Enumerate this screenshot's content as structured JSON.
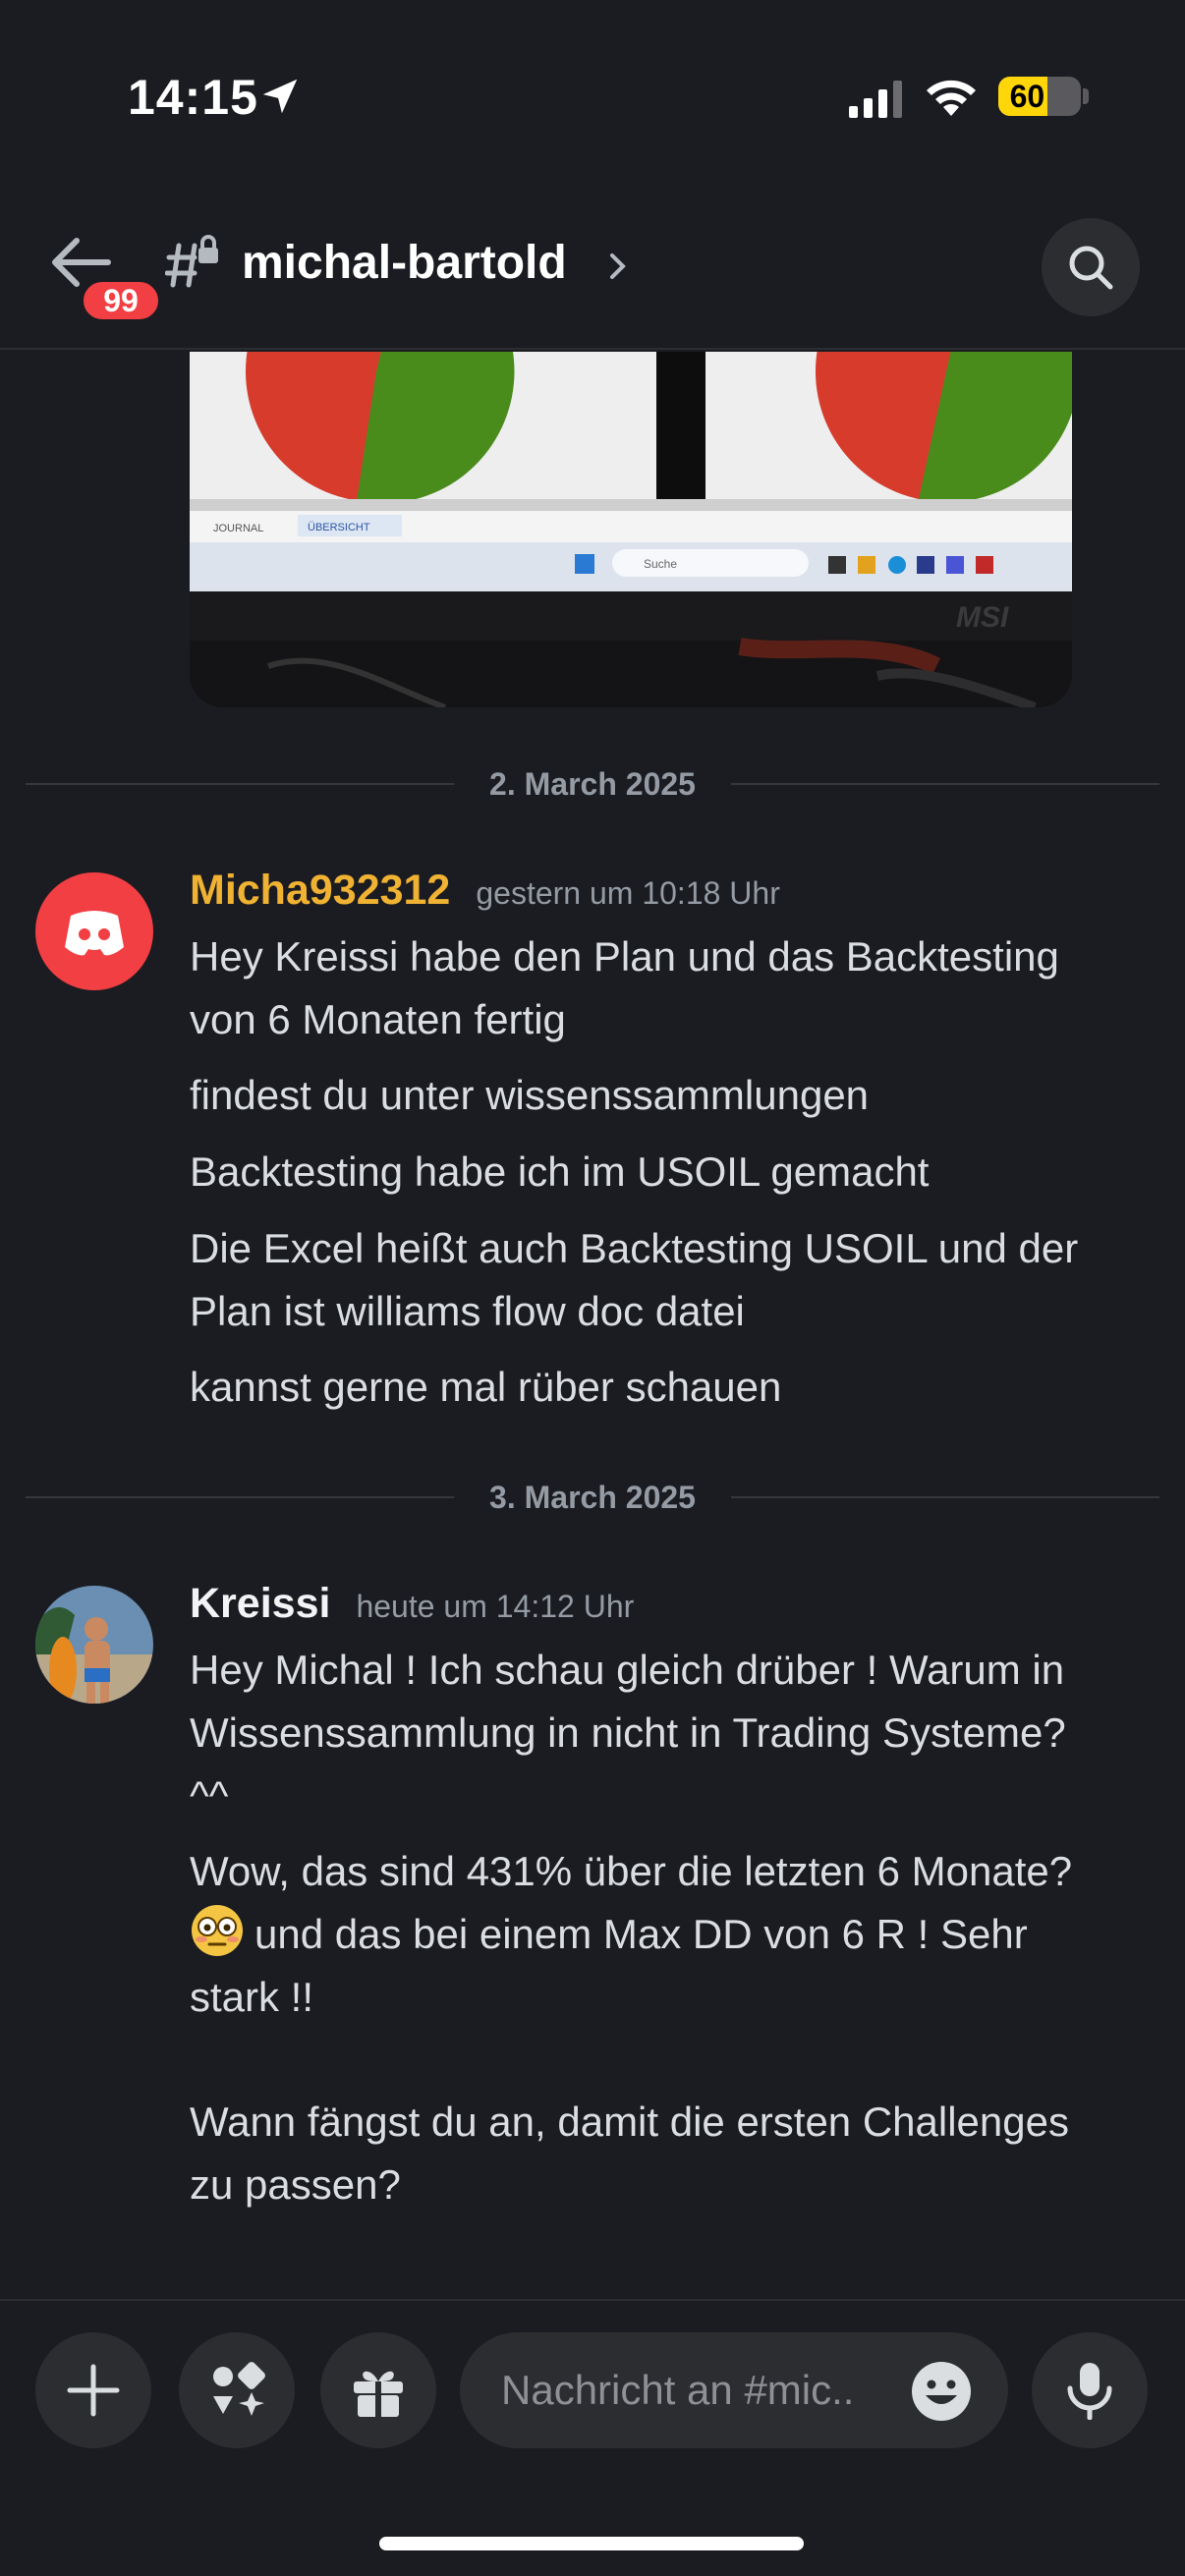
{
  "status_bar": {
    "time": "14:15",
    "battery_level": "60",
    "battery_percent": 60,
    "battery_color": "#ffd60a"
  },
  "header": {
    "unread_badge": "99",
    "channel_name": "michal-bartold"
  },
  "attachment": {
    "tab_journal": "JOURNAL",
    "tab_overview": "ÜBERSICHT",
    "taskbar_search": "Suche",
    "monitor_brand": "MSI"
  },
  "dividers": [
    "2. March 2025",
    "3. March 2025"
  ],
  "messages": [
    {
      "author": "Micha932312",
      "author_color": "#f0b232",
      "timestamp": "gestern um 10:18 Uhr",
      "lines": [
        "Hey Kreissi habe den Plan und das Backtesting\nvon 6 Monaten fertig",
        "findest du unter wissenssammlungen",
        "Backtesting habe ich im USOIL gemacht",
        "Die Excel heißt auch Backtesting USOIL und der\nPlan ist williams flow doc datei",
        "kannst gerne mal rüber schauen"
      ]
    },
    {
      "author": "Kreissi",
      "author_color": "#f2f3f5",
      "timestamp": "heute um 14:12 Uhr",
      "lines": [
        "Hey Michal ! Ich schau gleich drüber ! Warum in\nWissenssammlung in nicht in Trading Systeme?\n^^",
        "Wow, das sind 431% über die letzten 6 Monate?",
        "und das bei einem Max DD von 6 R ! Sehr\nstark !!",
        "Wann fängst du an, damit die ersten Challenges\nzu passen?"
      ],
      "emoji": "flushed-face"
    }
  ],
  "composer": {
    "placeholder": "Nachricht an #mic.."
  },
  "colors": {
    "accent_red": "#f23f43",
    "background": "#1b1c21",
    "surface": "#2b2d31"
  }
}
